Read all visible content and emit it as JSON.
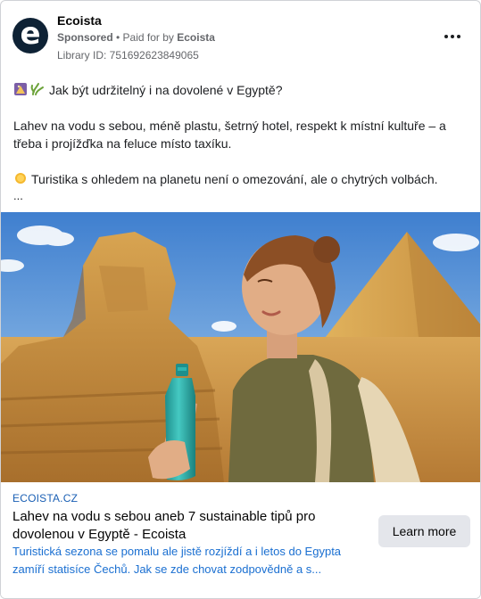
{
  "advertiser": {
    "name": "Ecoista",
    "avatar_letter": "e",
    "sponsored_label": "Sponsored",
    "paid_for_prefix": " • Paid for by ",
    "paid_for_name": "Ecoista",
    "library_id": "Library ID: 751692623849065"
  },
  "post": {
    "line1": "Jak být udržitelný i na dovolené v Egyptě?",
    "line2": "Lahev na vodu s sebou, méně plastu, šetrný hotel, respekt k místní kultuře – a třeba i projížďka na feluce místo taxíku.",
    "line3": "Turistika s ohledem na planetu není o omezování, ale o chytrých volbách.",
    "ellipsis": "..."
  },
  "link": {
    "domain": "ECOISTA.CZ",
    "title": "Lahev na vodu s sebou aneb 7 sustainable tipů pro dovolenou v Egyptě - Ecoista",
    "description": "Turistická sezona se pomalu ale jistě rozjíždí a i letos do Egypta zamíří statisíce Čechů. Jak se zde chovat zodpovědně a s...",
    "cta_label": "Learn more"
  },
  "colors": {
    "link_blue": "#1a6fd1",
    "avatar_bg": "#0e2235",
    "bottle_teal": "#2fb5b0"
  }
}
